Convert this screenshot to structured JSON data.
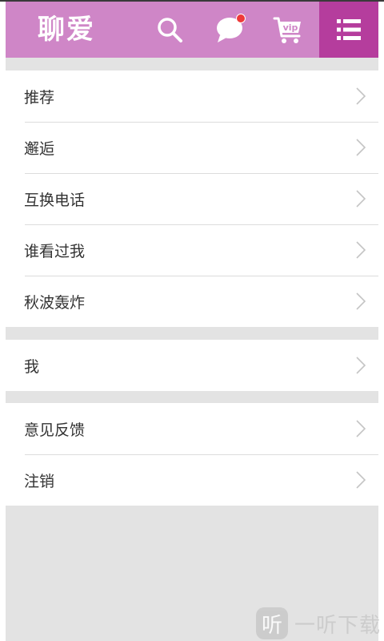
{
  "header": {
    "logo": "聊爱",
    "icons": {
      "search": "search-icon",
      "messages": "chat-bubble-icon",
      "vip": "vip-cart-icon",
      "menu": "list-menu-icon"
    },
    "vip_text": "vip"
  },
  "colors": {
    "header": "#cf86c7",
    "menu_active": "#b53d9d",
    "badge": "#ee3a3a",
    "background": "#e3e3e3"
  },
  "groups": [
    {
      "items": [
        {
          "label": "推荐"
        },
        {
          "label": "邂逅"
        },
        {
          "label": "互换电话"
        },
        {
          "label": "谁看过我"
        },
        {
          "label": "秋波轰炸"
        }
      ]
    },
    {
      "items": [
        {
          "label": "我"
        }
      ]
    },
    {
      "items": [
        {
          "label": "意见反馈"
        },
        {
          "label": "注销"
        }
      ]
    }
  ],
  "watermark": {
    "icon_char": "听",
    "text": "一听下载"
  }
}
